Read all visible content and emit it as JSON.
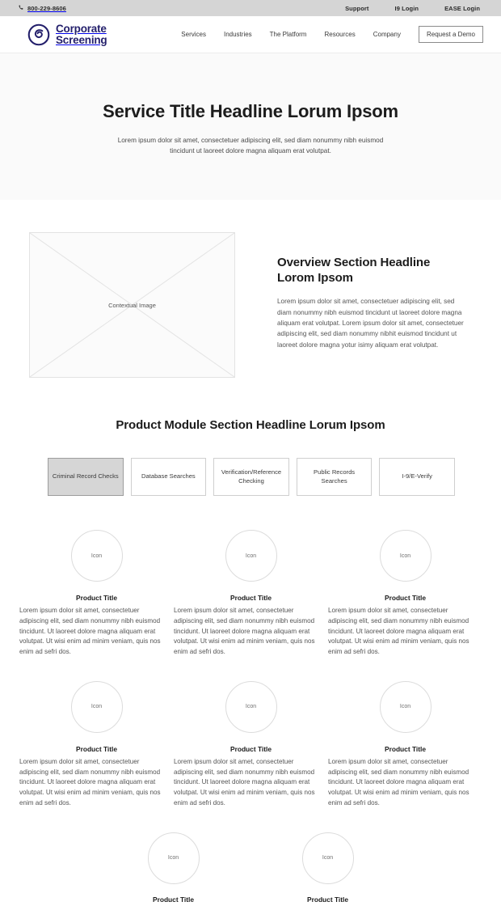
{
  "utility_bar": {
    "phone_icon": "phone-icon",
    "phone": "800-229-8606",
    "links": [
      {
        "label": "Support"
      },
      {
        "label": "I9 Login"
      },
      {
        "label": "EASE Login"
      }
    ]
  },
  "header": {
    "logo": {
      "icon": "spiral-logo-icon",
      "line1": "Corporate",
      "line2": "Screening",
      "color": "#231f6b"
    },
    "nav": [
      {
        "label": "Services"
      },
      {
        "label": "Industries"
      },
      {
        "label": "The Platform"
      },
      {
        "label": "Resources"
      },
      {
        "label": "Company"
      }
    ],
    "cta": {
      "label": "Request a Demo"
    }
  },
  "hero": {
    "title": "Service Title Headline Lorum Ipsom",
    "subtitle": "Lorem ipsum dolor sit amet, consectetuer adipiscing elit, sed diam nonummy nibh euismod tincidunt ut laoreet dolore magna aliquam erat volutpat.",
    "background": "#fafafa"
  },
  "overview": {
    "image_placeholder": "Contextual Image",
    "title": "Overview Section Headline Lorom Ipsom",
    "body": "Lorem ipsum dolor sit amet, consectetuer adipiscing elit, sed diam nonummy nibh euismod tincidunt ut laoreet dolore magna aliquam erat volutpat. Lorem ipsum dolor sit amet, consectetuer adipiscing elit, sed diam nonummy nibhit euismod tincidunt ut laoreet dolore magna yotur isimy aliquam erat volutpat."
  },
  "product_module": {
    "title": "Product Module Section Headline Lorum Ipsom",
    "tabs": [
      {
        "label": "Criminal Record Checks",
        "active": true
      },
      {
        "label": "Database Searches",
        "active": false
      },
      {
        "label": "Verification/Reference Checking",
        "active": false
      },
      {
        "label": "Public Records Searches",
        "active": false
      },
      {
        "label": "I-9/E-Verify",
        "active": false
      }
    ],
    "card_icon_label": "Icon",
    "cards": [
      {
        "title": "Product Title",
        "body": "Lorem ipsum dolor sit amet, consectetuer adipiscing elit, sed diam nonummy nibh euismod tincidunt. Ut laoreet dolore magna aliquam erat volutpat. Ut wisi enim ad minim veniam, quis nos enim ad sefri dos."
      },
      {
        "title": "Product Title",
        "body": "Lorem ipsum dolor sit amet, consectetuer adipiscing elit, sed diam nonummy nibh euismod tincidunt. Ut laoreet dolore magna aliquam erat volutpat. Ut wisi enim ad minim veniam, quis nos enim ad sefri dos."
      },
      {
        "title": "Product Title",
        "body": "Lorem ipsum dolor sit amet, consectetuer adipiscing elit, sed diam nonummy nibh euismod tincidunt. Ut laoreet dolore magna aliquam erat volutpat. Ut wisi enim ad minim veniam, quis nos enim ad sefri dos."
      },
      {
        "title": "Product Title",
        "body": "Lorem ipsum dolor sit amet, consectetuer adipiscing elit, sed diam nonummy nibh euismod tincidunt. Ut laoreet dolore magna aliquam erat volutpat. Ut wisi enim ad minim veniam, quis nos enim ad sefri dos."
      },
      {
        "title": "Product Title",
        "body": "Lorem ipsum dolor sit amet, consectetuer adipiscing elit, sed diam nonummy nibh euismod tincidunt. Ut laoreet dolore magna aliquam erat volutpat. Ut wisi enim ad minim veniam, quis nos enim ad sefri dos."
      },
      {
        "title": "Product Title",
        "body": "Lorem ipsum dolor sit amet, consectetuer adipiscing elit, sed diam nonummy nibh euismod tincidunt. Ut laoreet dolore magna aliquam erat volutpat. Ut wisi enim ad minim veniam, quis nos enim ad sefri dos."
      },
      {
        "title": "Product Title",
        "body": ""
      },
      {
        "title": "Product Title",
        "body": ""
      }
    ]
  }
}
